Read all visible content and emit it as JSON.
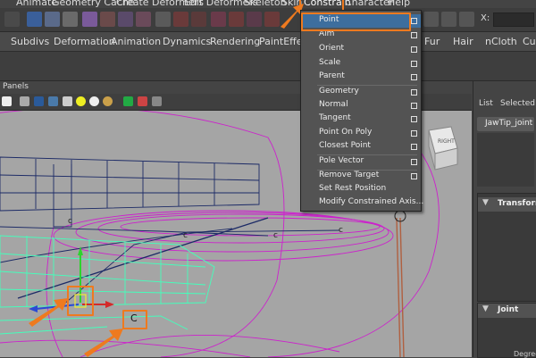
{
  "menubar": {
    "items": [
      "Animate",
      "Geometry Cache",
      "Create Deformers",
      "Edit Deformers",
      "Skeleton",
      "Skin",
      "Constrain",
      "Character",
      "Help"
    ]
  },
  "shelf": {
    "tabs": [
      "Subdivs",
      "Deformation",
      "Animation",
      "Dynamics",
      "Rendering",
      "PaintEffects",
      "Fur",
      "Hair",
      "nCloth",
      "Cust"
    ]
  },
  "toolbar": {
    "x_label": "X:"
  },
  "panels": {
    "label": "Panels"
  },
  "right_panel": {
    "tabs": [
      "List",
      "Selected"
    ],
    "node_name": "JawTip_joint",
    "transform_section": "Transform",
    "joint_section": "Joint",
    "degrees_label": "Degrees"
  },
  "constrain_menu": {
    "items": [
      {
        "label": "Point",
        "option_box": true,
        "highlighted": true
      },
      {
        "label": "Aim",
        "option_box": true
      },
      {
        "label": "Orient",
        "option_box": true
      },
      {
        "label": "Scale",
        "option_box": true
      },
      {
        "label": "Parent",
        "option_box": true
      },
      {
        "label": "Geometry",
        "option_box": true
      },
      {
        "label": "Normal",
        "option_box": true
      },
      {
        "label": "Tangent",
        "option_box": true
      },
      {
        "label": "Point On Poly",
        "option_box": true
      },
      {
        "label": "Closest Point",
        "option_box": true
      },
      {
        "label": "Pole Vector",
        "option_box": true
      },
      {
        "label": "Remove Target",
        "option_box": true
      },
      {
        "label": "Set Rest Position",
        "option_box": false
      },
      {
        "label": "Modify Constrained Axis...",
        "option_box": false
      }
    ]
  },
  "viewport": {
    "cube_label": "RIGHT",
    "locator_labels": [
      "c",
      "c",
      "c",
      "c"
    ],
    "highlight_label": "C"
  },
  "colors": {
    "accent": "#ee7a1f",
    "viewport_bg": "#a5a5a5",
    "nurbs_curve": "#cc22cc",
    "wireframe": "#1c2a66",
    "highlight_geo": "#44ffbb"
  }
}
